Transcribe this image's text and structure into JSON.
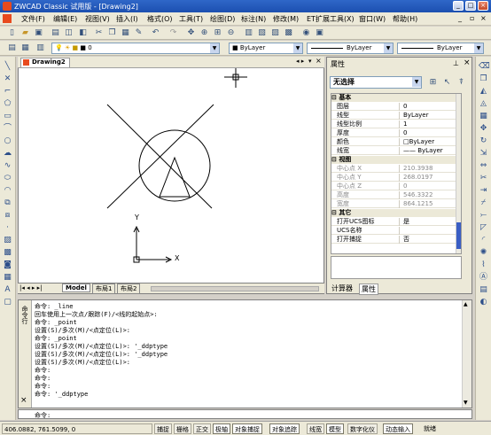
{
  "titlebar": {
    "title": "ZWCAD Classic 试用版 - [Drawing2]",
    "min": "_",
    "max": "□",
    "close": "×"
  },
  "menu": [
    "文件(F)",
    "编辑(E)",
    "视图(V)",
    "插入(I)",
    "格式(O)",
    "工具(T)",
    "绘图(D)",
    "标注(N)",
    "修改(M)",
    "ET扩展工具(X)",
    "窗口(W)",
    "帮助(H)"
  ],
  "mdi": {
    "min": "_",
    "restore": "▫",
    "close": "×"
  },
  "toolbar2": {
    "layer": "0",
    "color": "ByLayer",
    "linetype": "ByLayer",
    "lineweight": "ByLayer"
  },
  "document": {
    "tab": "Drawing2",
    "ucs_y": "Y",
    "ucs_x": "X"
  },
  "layouts": [
    "Model",
    "布局1",
    "布局2"
  ],
  "props": {
    "title": "属性",
    "selection": "无选择",
    "sections": {
      "basic": "基本",
      "view": "视图",
      "other": "其它"
    },
    "basic": [
      {
        "k": "图层",
        "v": "0"
      },
      {
        "k": "线型",
        "v": "ByLayer"
      },
      {
        "k": "线型比例",
        "v": "1"
      },
      {
        "k": "厚度",
        "v": "0"
      },
      {
        "k": "颜色",
        "v": "□ByLayer"
      },
      {
        "k": "线宽",
        "v": "—— ByLayer"
      }
    ],
    "view": [
      {
        "k": "中心点 X",
        "v": "210.3938"
      },
      {
        "k": "中心点 Y",
        "v": "268.0197"
      },
      {
        "k": "中心点 Z",
        "v": "0"
      },
      {
        "k": "高度",
        "v": "546.3322"
      },
      {
        "k": "宽度",
        "v": "864.1215"
      }
    ],
    "other": [
      {
        "k": "打开UCS图标",
        "v": "是"
      },
      {
        "k": "UCS名称",
        "v": ""
      },
      {
        "k": "打开捕捉",
        "v": "否"
      }
    ],
    "tabs": [
      "计算器",
      "属性"
    ]
  },
  "command": {
    "side_label": "命令行",
    "lines": [
      "命令: _line",
      "回车使用上一次点/跟踪(F)/<线的起始点>:",
      "命令: _point",
      "设置(S)/多次(M)/<点定位(L)>:",
      "命令: _point",
      "设置(S)/多次(M)/<点定位(L)>: '_ddptype",
      "设置(S)/多次(M)/<点定位(L)>: '_ddptype",
      "设置(S)/多次(M)/<点定位(L)>:",
      "命令:",
      "命令:",
      "命令:",
      "命令: '_ddptype"
    ],
    "prompt": "命令:"
  },
  "status": {
    "coords": "406.0882,  761.5099,  0",
    "buttons": [
      "捕捉",
      "栅格",
      "正交",
      "极轴",
      "对象捕捉",
      "对象追踪",
      "线宽",
      "模型",
      "数字化仪",
      "动态输入",
      "就绪"
    ]
  }
}
